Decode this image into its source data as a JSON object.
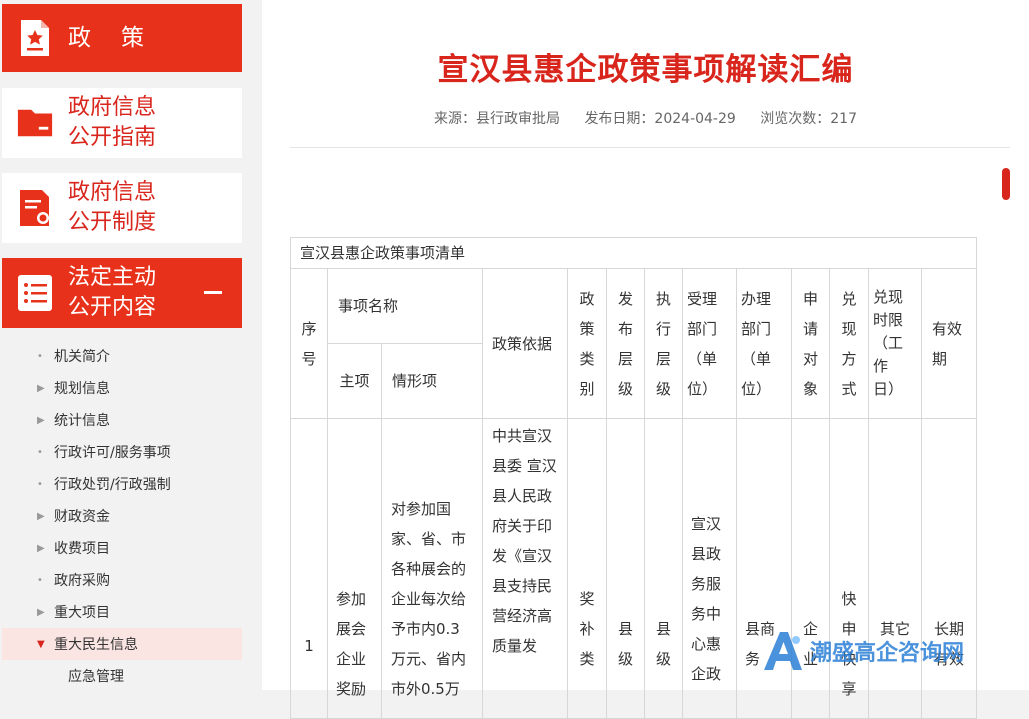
{
  "sidebar": {
    "blocks": [
      {
        "label": "政策"
      },
      {
        "label_line1": "政府信息",
        "label_line2": "公开指南"
      },
      {
        "label_line1": "政府信息",
        "label_line2": "公开制度"
      },
      {
        "label_line1": "法定主动",
        "label_line2": "公开内容"
      }
    ],
    "menu": [
      {
        "label": "机关简介",
        "marker": "•"
      },
      {
        "label": "规划信息",
        "marker": "▶"
      },
      {
        "label": "统计信息",
        "marker": "▶"
      },
      {
        "label": "行政许可/服务事项",
        "marker": "•"
      },
      {
        "label": "行政处罚/行政强制",
        "marker": "•"
      },
      {
        "label": "财政资金",
        "marker": "▶"
      },
      {
        "label": "收费项目",
        "marker": "▶"
      },
      {
        "label": "政府采购",
        "marker": "•"
      },
      {
        "label": "重大项目",
        "marker": "▶"
      },
      {
        "label": "重大民生信息",
        "marker": "▼"
      },
      {
        "label": "应急管理",
        "marker": ""
      }
    ]
  },
  "article": {
    "title": "宣汉县惠企政策事项解读汇编",
    "source": "来源：县行政审批局",
    "date": "发布日期：2024-04-29",
    "views": "浏览次数：217"
  },
  "table": {
    "caption": "宣汉县惠企政策事项清单",
    "headers": {
      "seq": "序号",
      "item_name": "事项名称",
      "main_item": "主项",
      "sub_item": "情形项",
      "basis": "政策依据",
      "category": "政策类别",
      "issue_level": "发布层级",
      "exec_level": "执行层级",
      "accept_dept": "受理部门（单位）",
      "handle_dept": "办理部门（单位）",
      "applicant": "申请对象",
      "method": "兑现方式",
      "time_limit": "兑现时限（工作日）",
      "validity": "有效期"
    },
    "row1": {
      "seq": "1",
      "main_item": "参加展会企业奖励",
      "sub_item": "对参加国家、省、市各种展会的企业每次给予市内0.3万元、省内市外0.5万",
      "basis": "中共宣汉县委 宣汉县人民政府关于印发《宣汉县支持民营经济高质量发",
      "category": "奖补类",
      "issue_level": "县级",
      "exec_level": "县级",
      "accept_dept": "宣汉县政务服务中心惠企政",
      "handle_dept": "县商务",
      "applicant": "企业",
      "method": "快申快享",
      "time_limit": "其它",
      "validity": "长期有效"
    }
  },
  "watermark": {
    "text": "潮盛高企咨询网"
  },
  "colors": {
    "accent": "#e8311a",
    "title_red": "#d9261c"
  }
}
